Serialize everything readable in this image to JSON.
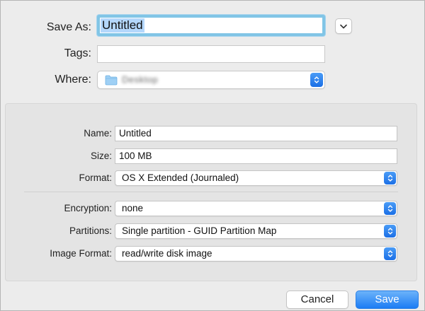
{
  "save_as": {
    "label": "Save As:",
    "value": "Untitled"
  },
  "tags": {
    "label": "Tags:",
    "value": ""
  },
  "where": {
    "label": "Where:",
    "value": "Desktop",
    "icon": "folder-icon"
  },
  "image_options": {
    "name": {
      "label": "Name:",
      "value": "Untitled"
    },
    "size": {
      "label": "Size:",
      "value": "100 MB"
    },
    "format": {
      "label": "Format:",
      "value": "OS X Extended (Journaled)"
    },
    "encryption": {
      "label": "Encryption:",
      "value": "none"
    },
    "partitions": {
      "label": "Partitions:",
      "value": "Single partition - GUID Partition Map"
    },
    "image_format": {
      "label": "Image Format:",
      "value": "read/write disk image"
    }
  },
  "buttons": {
    "cancel": "Cancel",
    "save": "Save"
  },
  "colors": {
    "accent": "#1c7cf4",
    "focus_ring": "#81c5e6",
    "selection": "#b4d7fb"
  }
}
